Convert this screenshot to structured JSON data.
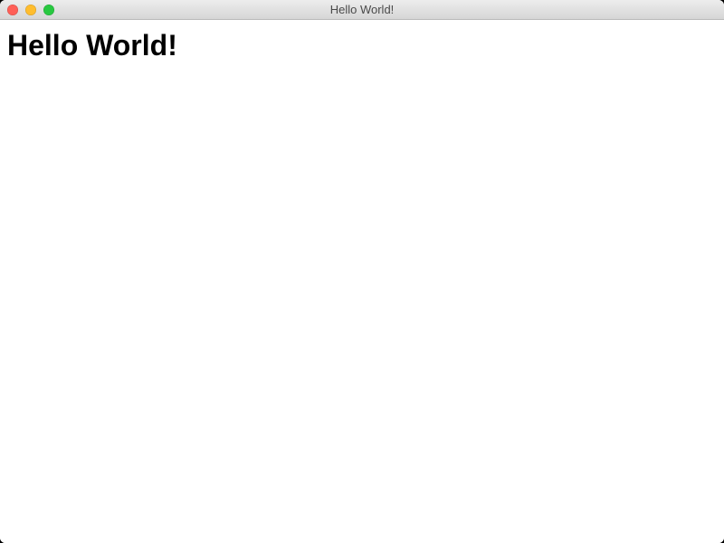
{
  "window": {
    "title": "Hello World!"
  },
  "content": {
    "heading": "Hello World!"
  }
}
